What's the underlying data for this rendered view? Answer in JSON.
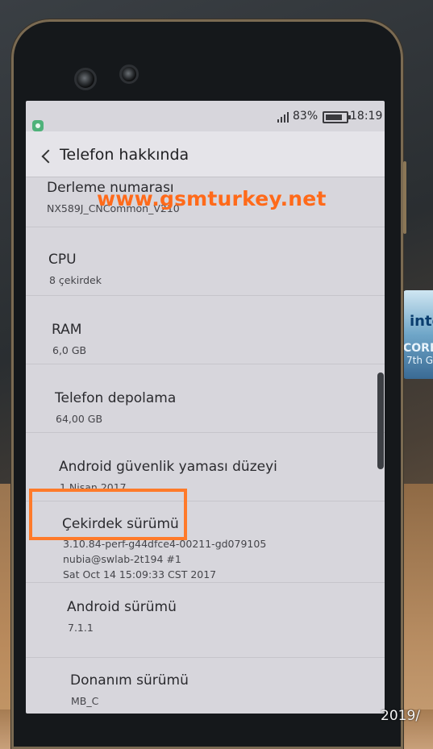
{
  "status_bar": {
    "battery": "83%",
    "time": "18:19"
  },
  "header": {
    "title": "Telefon hakkında"
  },
  "items": [
    {
      "label": "Derleme numarası",
      "value": "NX589J_CNCommon_V210"
    },
    {
      "label": "CPU",
      "value": "8 çekirdek"
    },
    {
      "label": "RAM",
      "value": "6,0 GB"
    },
    {
      "label": "Telefon depolama",
      "value": "64,00 GB"
    },
    {
      "label": "Android güvenlik yaması düzeyi",
      "value": "1 Nisan 2017"
    },
    {
      "label": "Çekirdek sürümü",
      "value_lines": [
        "3.10.84-perf-g44dfce4-00211-gd079105",
        "nubia@swlab-2t194 #1",
        "Sat Oct 14 15:09:33 CST 2017"
      ]
    },
    {
      "label": "Android sürümü",
      "value": "7.1.1"
    },
    {
      "label": "Donanım sürümü",
      "value": "MB_C"
    }
  ],
  "watermark": "www.gsmturkey.net",
  "photo_date": "2019/",
  "background_sticker": {
    "brand": "inte",
    "line1": "CORE",
    "line2": "7th G"
  },
  "colors": {
    "highlight": "#ff7a2a",
    "watermark": "#ff6a1a"
  }
}
